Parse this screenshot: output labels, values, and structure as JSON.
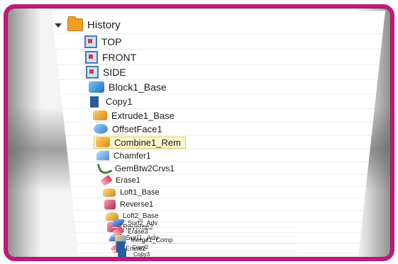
{
  "tree": {
    "root_label": "History",
    "items": [
      {
        "label": "TOP",
        "icon": "plane-icon"
      },
      {
        "label": "FRONT",
        "icon": "plane-icon"
      },
      {
        "label": "SIDE",
        "icon": "plane-icon"
      },
      {
        "label": "Block1_Base",
        "icon": "block-icon"
      },
      {
        "label": "Copy1",
        "icon": "copy-icon"
      },
      {
        "label": "Extrude1_Base",
        "icon": "extrude-icon"
      },
      {
        "label": "OffsetFace1",
        "icon": "offset-face-icon"
      },
      {
        "label": "Combine1_Rem",
        "icon": "combine-icon",
        "selected": true
      },
      {
        "label": "Chamfer1",
        "icon": "chamfer-icon"
      },
      {
        "label": "GemBtw2Crvs1",
        "icon": "curve-icon"
      },
      {
        "label": "Erase1",
        "icon": "erase-icon"
      },
      {
        "label": "Loft1_Base",
        "icon": "loft-icon"
      },
      {
        "label": "Reverse1",
        "icon": "reverse-icon"
      },
      {
        "label": "Loft2_Base",
        "icon": "loft-icon"
      },
      {
        "label": "Reverse2",
        "icon": "reverse-icon"
      },
      {
        "label": "Surf1_Adv",
        "icon": "surface-icon"
      },
      {
        "label": "Erase2",
        "icon": "erase-icon"
      },
      {
        "label": "Surf2_Adv",
        "icon": "surface-icon"
      },
      {
        "label": "Erase3",
        "icon": "erase-icon"
      },
      {
        "label": "Merge1_Comp",
        "icon": "merge-icon"
      },
      {
        "label": "Copy2",
        "icon": "copy-icon"
      },
      {
        "label": "Copy3",
        "icon": "copy-icon"
      }
    ]
  },
  "colors": {
    "frame": "#c4177e",
    "selection_fill": "#fff8cc",
    "selection_border": "#e6c84f"
  }
}
